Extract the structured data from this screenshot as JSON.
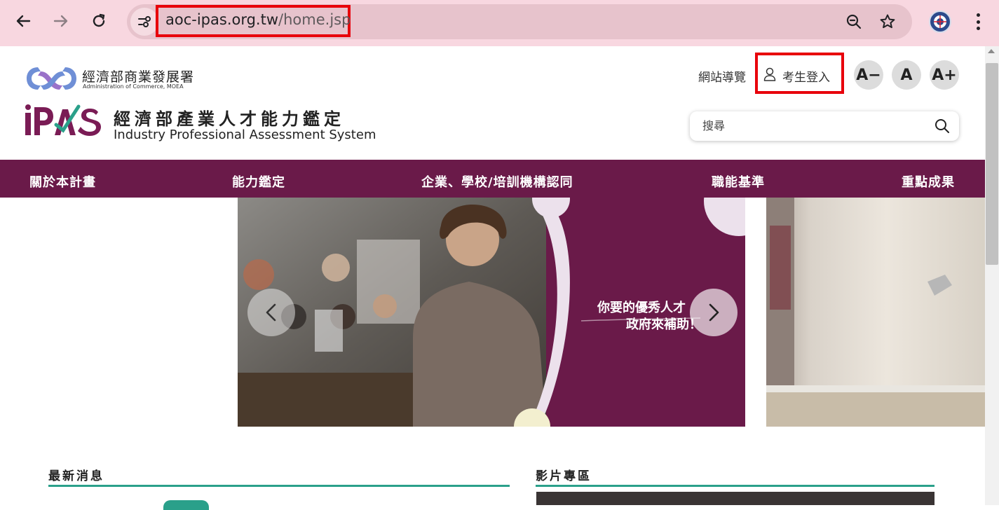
{
  "browser": {
    "url_host": "aoc-ipas.org.tw",
    "url_path": "/home.jsp",
    "icons": [
      "back-arrow-icon",
      "forward-arrow-icon",
      "reload-icon",
      "site-settings-icon",
      "zoom-icon",
      "bookmark-star-icon",
      "profile-avatar-icon",
      "more-menu-icon"
    ]
  },
  "header": {
    "moea_name": "經濟部商業發展署",
    "moea_english": "Administration of Commerce, MOEA",
    "ipas_logo_text": "iPAS",
    "ipas_title": "經濟部產業人才能力鑑定",
    "ipas_subtitle": "Industry Professional Assessment System",
    "sitemap_label": "網站導覽",
    "login_label": "考生登入",
    "font_small": "A−",
    "font_normal": "A",
    "font_large": "A+",
    "search_placeholder": "搜尋"
  },
  "nav": {
    "items": [
      "關於本計畫",
      "能力鑑定",
      "企業、學校/培訓機構認同",
      "職能基準",
      "重點成果"
    ]
  },
  "banner": {
    "slogan_line1": "你要的優秀人才",
    "slogan_line2": "政府來補助！"
  },
  "sections": {
    "news_title": "最新消息",
    "video_title": "影片專區"
  },
  "colors": {
    "nav_bg": "#6a1a49",
    "accent_line": "#2aa08a",
    "highlight_box": "#e8000b",
    "chrome_bg": "#f8d7e0"
  }
}
